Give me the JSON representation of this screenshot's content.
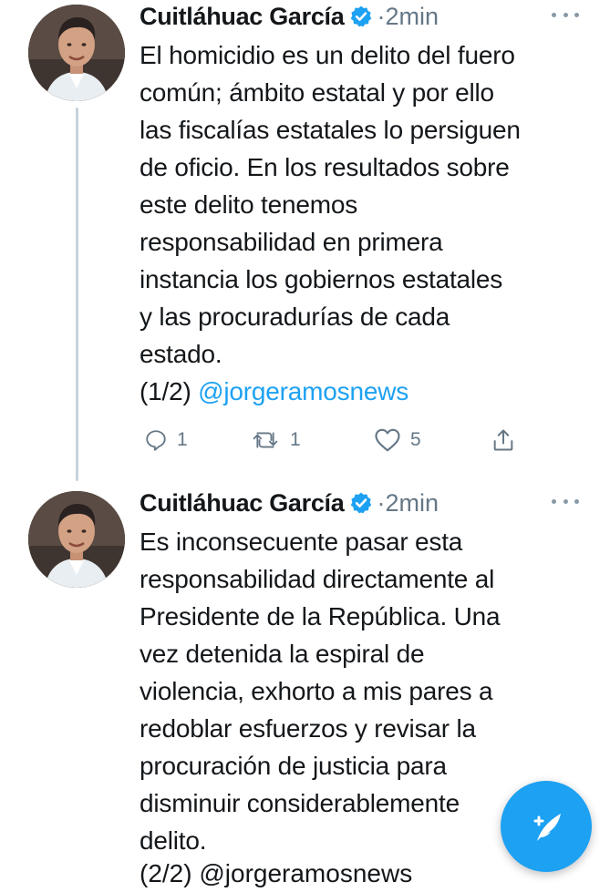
{
  "colors": {
    "link": "#1da1f2",
    "secondary_text": "#657786",
    "thread_line": "#c8d2da",
    "fab": "#1da1f2"
  },
  "tweets": [
    {
      "author": "Cuitláhuac García",
      "verified_icon": "verified-badge-icon",
      "separator": "·",
      "time": "2min",
      "lines": [
        "El homicidio es un delito del fuero",
        "común; ámbito estatal y por ello",
        "las fiscalías estatales lo persiguen",
        "de oficio. En los resultados sobre",
        "este delito tenemos",
        "responsabilidad en primera",
        "instancia los gobiernos estatales",
        "y las procuradurías de cada",
        "estado."
      ],
      "suffix": "(1/2)",
      "mention": "@jorgeramosnews",
      "replies": "1",
      "retweets": "1",
      "likes": "5"
    },
    {
      "author": "Cuitláhuac García",
      "verified_icon": "verified-badge-icon",
      "separator": "·",
      "time": "2min",
      "lines": [
        "Es inconsecuente pasar esta",
        "responsabilidad directamente al",
        "Presidente de la República. Una",
        "vez detenida la espiral de",
        "violencia, exhorto a mis pares a",
        "redoblar esfuerzos y revisar la",
        "procuración de justicia para",
        "disminuir considerablemente",
        "delito."
      ],
      "cut_line": "(2/2) @jorgeramosnews"
    }
  ],
  "fab_icon": "compose-tweet-icon"
}
